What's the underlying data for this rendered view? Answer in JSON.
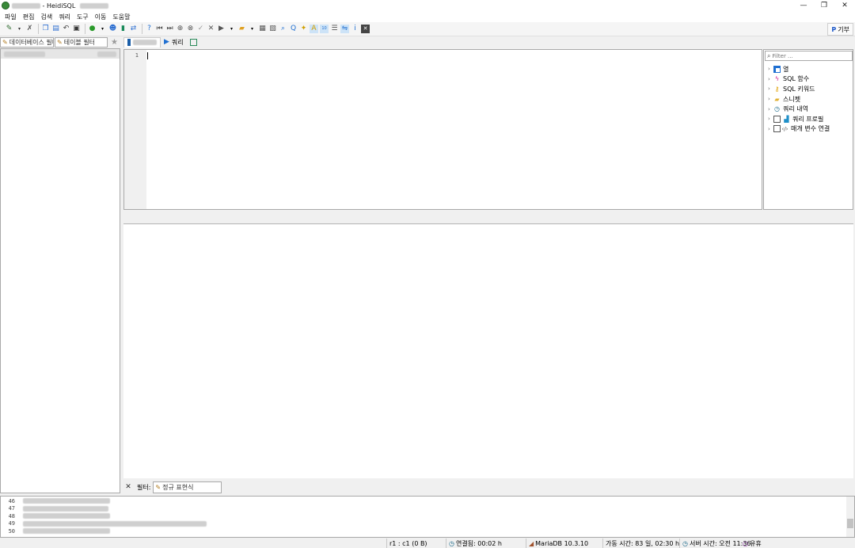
{
  "title": {
    "app": "HeidiSQL",
    "separator": " - "
  },
  "window_controls": {
    "minimize": "—",
    "restore": "❐",
    "close": "✕"
  },
  "menu": [
    "파일",
    "편집",
    "검색",
    "쿼리",
    "도구",
    "이동",
    "도움말"
  ],
  "toolbar": {
    "donate_label": "기부"
  },
  "left_filters": {
    "database_filter": "데이터베이스 필터",
    "table_filter": "테이블 필터"
  },
  "tabs": {
    "query_label": "쿼리"
  },
  "editor": {
    "line_number": "1"
  },
  "helper": {
    "filter_placeholder": "Filter ...",
    "items": [
      {
        "label": "열",
        "icon": "columns-icon"
      },
      {
        "label": "SQL 함수",
        "icon": "lightning-icon"
      },
      {
        "label": "SQL 키워드",
        "icon": "key-icon"
      },
      {
        "label": "스니펫",
        "icon": "folder-icon"
      },
      {
        "label": "쿼리 내역",
        "icon": "clock-icon"
      },
      {
        "label": "쿼리 프로필",
        "icon": "chart-icon"
      },
      {
        "label": "매개 변수 연결",
        "icon": "code-icon"
      }
    ]
  },
  "bottom_filter": {
    "close": "✕",
    "label": "필터:",
    "regex_label": "정규 표현식"
  },
  "log": {
    "line_numbers": [
      "46",
      "47",
      "48",
      "49",
      "50"
    ]
  },
  "status": {
    "cursor": "r1 : c1 (0 B)",
    "connected": "연결됨: 00:02 h",
    "server": "MariaDB 10.3.10",
    "uptime": "가동 시간: 83 일, 02:30 h",
    "server_time": "서버 시간: 오전 11:36",
    "idle": "유휴"
  },
  "colors": {
    "accent": "#1f6fd1",
    "panel_border": "#a9a9a9",
    "background": "#f0f0f0"
  }
}
